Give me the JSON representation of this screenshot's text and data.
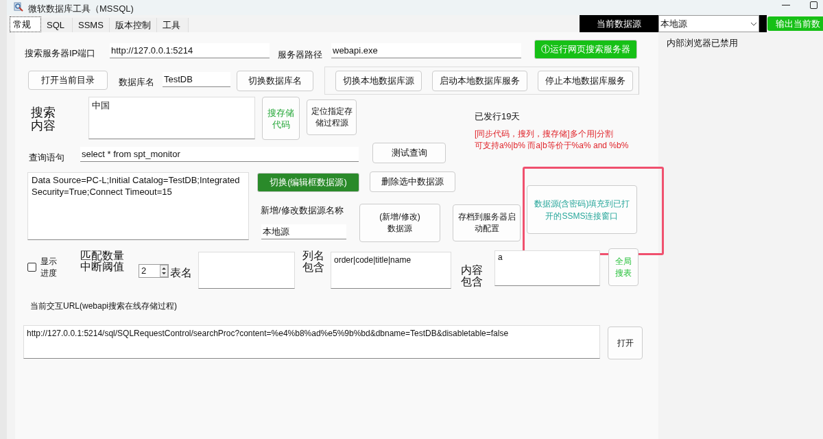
{
  "window": {
    "title": "微软数据库工具（MSSQL)"
  },
  "tabs": [
    {
      "label": "常规",
      "selected": true
    },
    {
      "label": "SQL",
      "selected": false
    },
    {
      "label": "SSMS",
      "selected": false
    },
    {
      "label": "版本控制",
      "selected": false
    },
    {
      "label": "工具",
      "selected": false
    }
  ],
  "datasource": {
    "label": "当前数据源",
    "value": "本地源",
    "export_button": "输出当前数"
  },
  "browser_status": "内部浏览器已禁用",
  "server": {
    "ip_label": "搜索服务器IP端口",
    "ip_value": "http://127.0.0.1:5214",
    "path_label": "服务器路径",
    "path_value": "webapi.exe",
    "run_button": "①运行网页搜索服务器"
  },
  "database": {
    "open_dir_button": "打开当前目录",
    "name_label": "数据库名",
    "name_value": "TestDB",
    "switch_button": "切换数据库名"
  },
  "local_db_buttons": [
    "切换本地数据库源",
    "启动本地数据库服务",
    "停止本地数据库服务"
  ],
  "search": {
    "label": "搜索内容",
    "value": "中国",
    "search_code_button": "搜存储代码",
    "locate_button": "定位指定存储过程源"
  },
  "release_note": "已发行19天",
  "hint_lines": [
    "[同步代码，搜列，搜存储]多个用|分割",
    "可支持a%|b% 而a|b等价于%a% and %b%"
  ],
  "query": {
    "label": "查询语句",
    "value": "select * from spt_monitor",
    "test_button": "测试查询"
  },
  "connection": {
    "value": "Data Source=PC-L;Initial Catalog=TestDB;Integrated Security=True;Connect Timeout=15",
    "switch_button": "切换(编辑框数据源)",
    "delete_button": "删除选中数据源",
    "name_label": "新增/修改数据源名称",
    "name_value": "本地源",
    "save_button": "(新增/修改)\n数据源",
    "archive_button": "存档到服务器启动配置",
    "fill_ssms_button": "数据源(含密码)填充到已打开的SSMS连接窗口"
  },
  "table_search": {
    "show_progress": {
      "label": "显示进度",
      "checked": false
    },
    "threshold_label": "匹配数量中断阈值",
    "threshold_value": "2",
    "table_label": "表名",
    "column_label": "列名包含",
    "column_value": "order|code|title|name",
    "content_label": "内容包含",
    "content_value": "a",
    "global_button": "全局搜表"
  },
  "url": {
    "label": "当前交互URL(webapi搜索在线存储过程)",
    "value": "http://127.0.0.1:5214/sql/SQLRequestControl/searchProc?content=%e4%b8%ad%e5%9b%bd&dbname=TestDB&disabletable=false",
    "open_button": "打开"
  }
}
